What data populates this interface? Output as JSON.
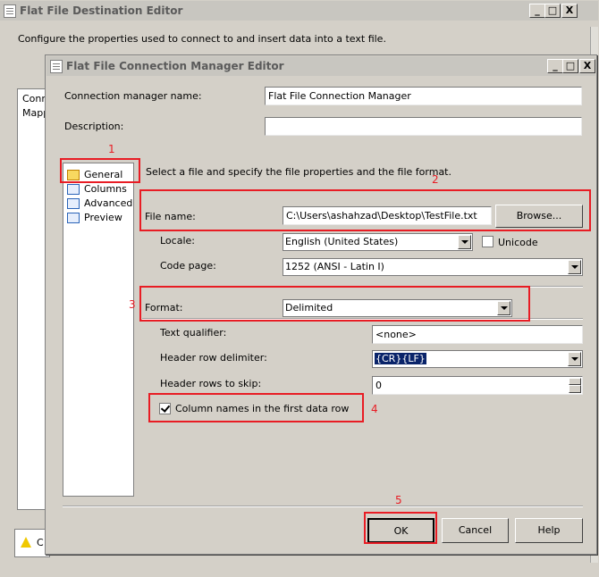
{
  "outer": {
    "title": "Flat File Destination Editor",
    "description": "Configure the properties used to connect to and insert data into a text file.",
    "list_items": [
      "Conn",
      "Mapp"
    ],
    "warning_letter": "C",
    "controls": [
      "_",
      "□",
      "X"
    ]
  },
  "dialog": {
    "title": "Flat File Connection Manager Editor",
    "controls": [
      "_",
      "□",
      "X"
    ],
    "connection_name_label": "Connection manager name:",
    "connection_name_value": "Flat File Connection Manager",
    "description_label": "Description:",
    "description_value": "",
    "nav": [
      "General",
      "Columns",
      "Advanced",
      "Preview"
    ],
    "instructions": "Select a file and specify the file properties and the file format.",
    "file_name_label": "File name:",
    "file_name_value": "C:\\Users\\ashahzad\\Desktop\\TestFile.txt",
    "browse_label": "Browse...",
    "locale_label": "Locale:",
    "locale_value": "English (United States)",
    "unicode_label": "Unicode",
    "unicode_checked": false,
    "code_page_label": "Code page:",
    "code_page_value": "1252  (ANSI - Latin I)",
    "format_label": "Format:",
    "format_value": "Delimited",
    "text_qualifier_label": "Text qualifier:",
    "text_qualifier_value": "<none>",
    "header_delim_label": "Header row delimiter:",
    "header_delim_value": "{CR}{LF}",
    "header_skip_label": "Header rows to skip:",
    "header_skip_value": "0",
    "col_names_label": "Column names in the first data row",
    "col_names_checked": true,
    "ok_label": "OK",
    "cancel_label": "Cancel",
    "help_label": "Help"
  },
  "annotations": [
    "1",
    "2",
    "3",
    "4",
    "5"
  ],
  "colors": {
    "annotation": "#e81c24",
    "selection": "#0a246a",
    "dialog_bg": "#d4d0c8"
  }
}
